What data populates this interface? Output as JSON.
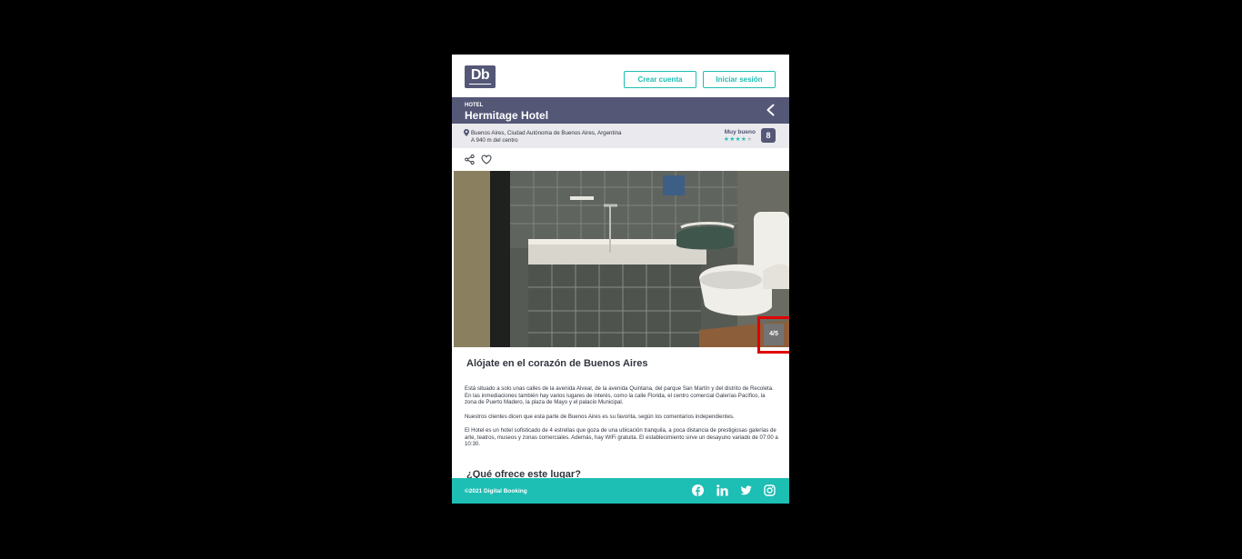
{
  "header": {
    "logo_text": "Db",
    "create_account": "Crear cuenta",
    "login": "Iniciar sesión"
  },
  "hotel": {
    "category": "HOTEL",
    "name": "Hermitage Hotel",
    "address": "Buenos Aires, Ciudad Autónoma de Buenos Aires, Argentina",
    "distance": "A 940 m del centro",
    "rating_text": "Muy bueno",
    "stars": 4,
    "stars_max": 5,
    "score": "8"
  },
  "gallery": {
    "counter": "4/5",
    "current": 4,
    "total": 5
  },
  "description": {
    "title": "Alójate en el corazón de Buenos Aires",
    "paragraph1": "Está situado a solo unas calles de la avenida Alvear, de la avenida Quintana, del parque San Martín y del distrito de Recoleta. En las inmediaciones también hay varios lugares de interés, como la calle Florida, el centro comercial Galerías Pacífico, la zona de Puerto Madero, la plaza de Mayo y el palacio Municipal.",
    "paragraph2": "Nuestros clientes dicen que esta parte de Buenos Aires es su favorita, según los comentarios independientes.",
    "paragraph3": "El Hotel es un hotel sofisticado de 4 estrellas que goza de una ubicación tranquila, a poca distancia de prestigiosas galerías de arte, teatros, museos y zonas comerciales. Además, hay WiFi gratuita. El establecimiento sirve un desayuno variado de 07:00 a 10:30.",
    "offer_title": "¿Qué ofrece este lugar?"
  },
  "footer": {
    "copyright": "©2021 Digital Booking"
  },
  "colors": {
    "primary": "#545776",
    "accent": "#1dbeb4",
    "text": "#31363f",
    "highlight": "#e00000"
  },
  "icons": [
    "location-pin-icon",
    "chevron-left-icon",
    "share-icon",
    "heart-icon",
    "facebook-icon",
    "linkedin-icon",
    "twitter-icon",
    "instagram-icon"
  ]
}
